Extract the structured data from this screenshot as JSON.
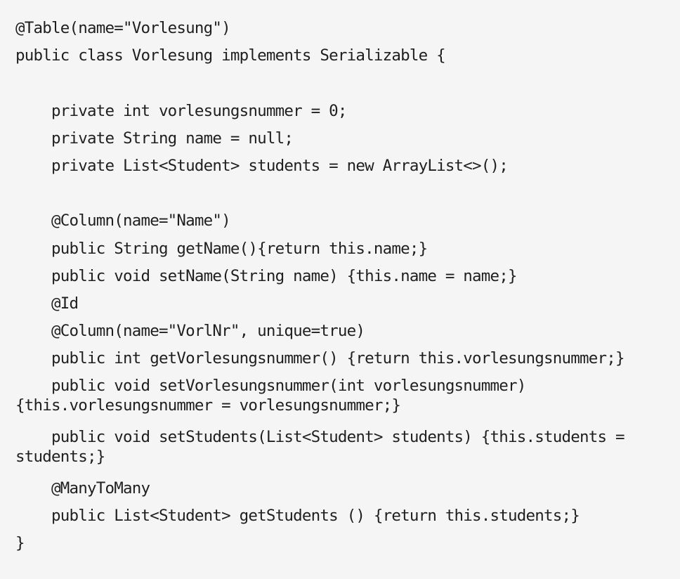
{
  "code": {
    "lines": [
      "@Table(name=\"Vorlesung\")",
      "public class Vorlesung implements Serializable {",
      "",
      "    private int vorlesungsnummer = 0;",
      "    private String name = null;",
      "    private List<Student> students = new ArrayList<>();",
      "",
      "    @Column(name=\"Name\")",
      "    public String getName(){return this.name;}",
      "    public void setName(String name) {this.name = name;}",
      "    @Id",
      "    @Column(name=\"VorlNr\", unique=true)",
      "    public int getVorlesungsnummer() {return this.vorlesungsnummer;}",
      "    public void setVorlesungsnummer(int vorlesungsnummer)",
      "{this.vorlesungsnummer = vorlesungsnummer;}",
      "    public void setStudents(List<Student> students) {this.students =",
      "students;}",
      "    @ManyToMany",
      "    public List<Student> getStudents () {return this.students;}",
      "}"
    ]
  }
}
